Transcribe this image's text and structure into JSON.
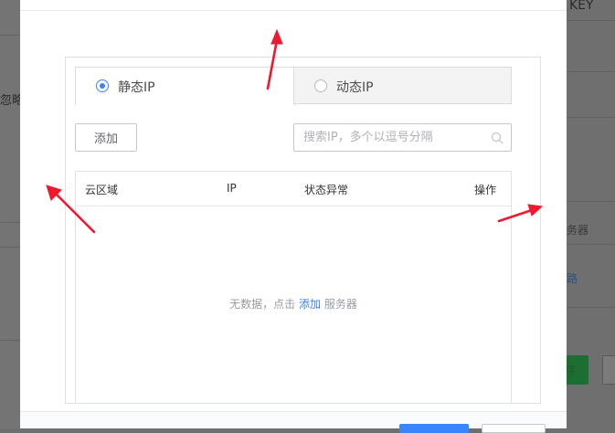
{
  "background": {
    "key_text": "KEY",
    "lue_text": "忽略",
    "qi_text": "务器",
    "lu_text": "路"
  },
  "tabs": [
    {
      "label": "静态IP",
      "selected": true
    },
    {
      "label": "动态IP",
      "selected": false
    }
  ],
  "toolbar": {
    "add_label": "添加",
    "search_placeholder": "搜索IP，多个以逗号分隔"
  },
  "table": {
    "columns": [
      "云区域",
      "IP",
      "状态异常",
      "操作"
    ],
    "rows": [],
    "empty_prefix": "无数据，点击",
    "empty_link": "添加",
    "empty_suffix": "服务器"
  },
  "colors": {
    "accent": "#3a84ff",
    "annotation_arrow": "#f0182f"
  }
}
